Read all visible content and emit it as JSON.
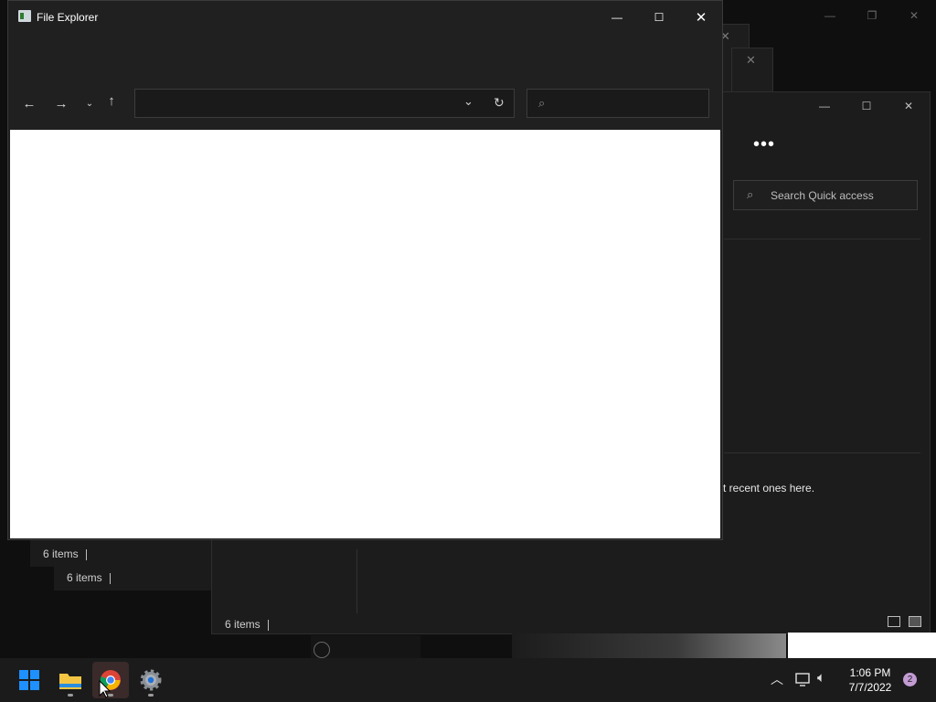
{
  "front_window": {
    "title": "File Explorer",
    "address_value": "",
    "search_placeholder": ""
  },
  "back_window_1": {
    "search_placeholder": "Search Quick access",
    "message_fragment": "t recent ones here.",
    "status": "6 items"
  },
  "back_window_2": {
    "status": "6 items"
  },
  "back_window_3": {
    "status": "6 items"
  },
  "taskbar": {
    "time": "1:06 PM",
    "date": "7/7/2022",
    "notification_count": "2",
    "apps": [
      "Start",
      "File Explorer",
      "Google Chrome",
      "Settings"
    ]
  },
  "colors": {
    "accent_blue": "#1e90ff",
    "folder_yellow": "#f4c542",
    "badge": "#c39bd3"
  }
}
